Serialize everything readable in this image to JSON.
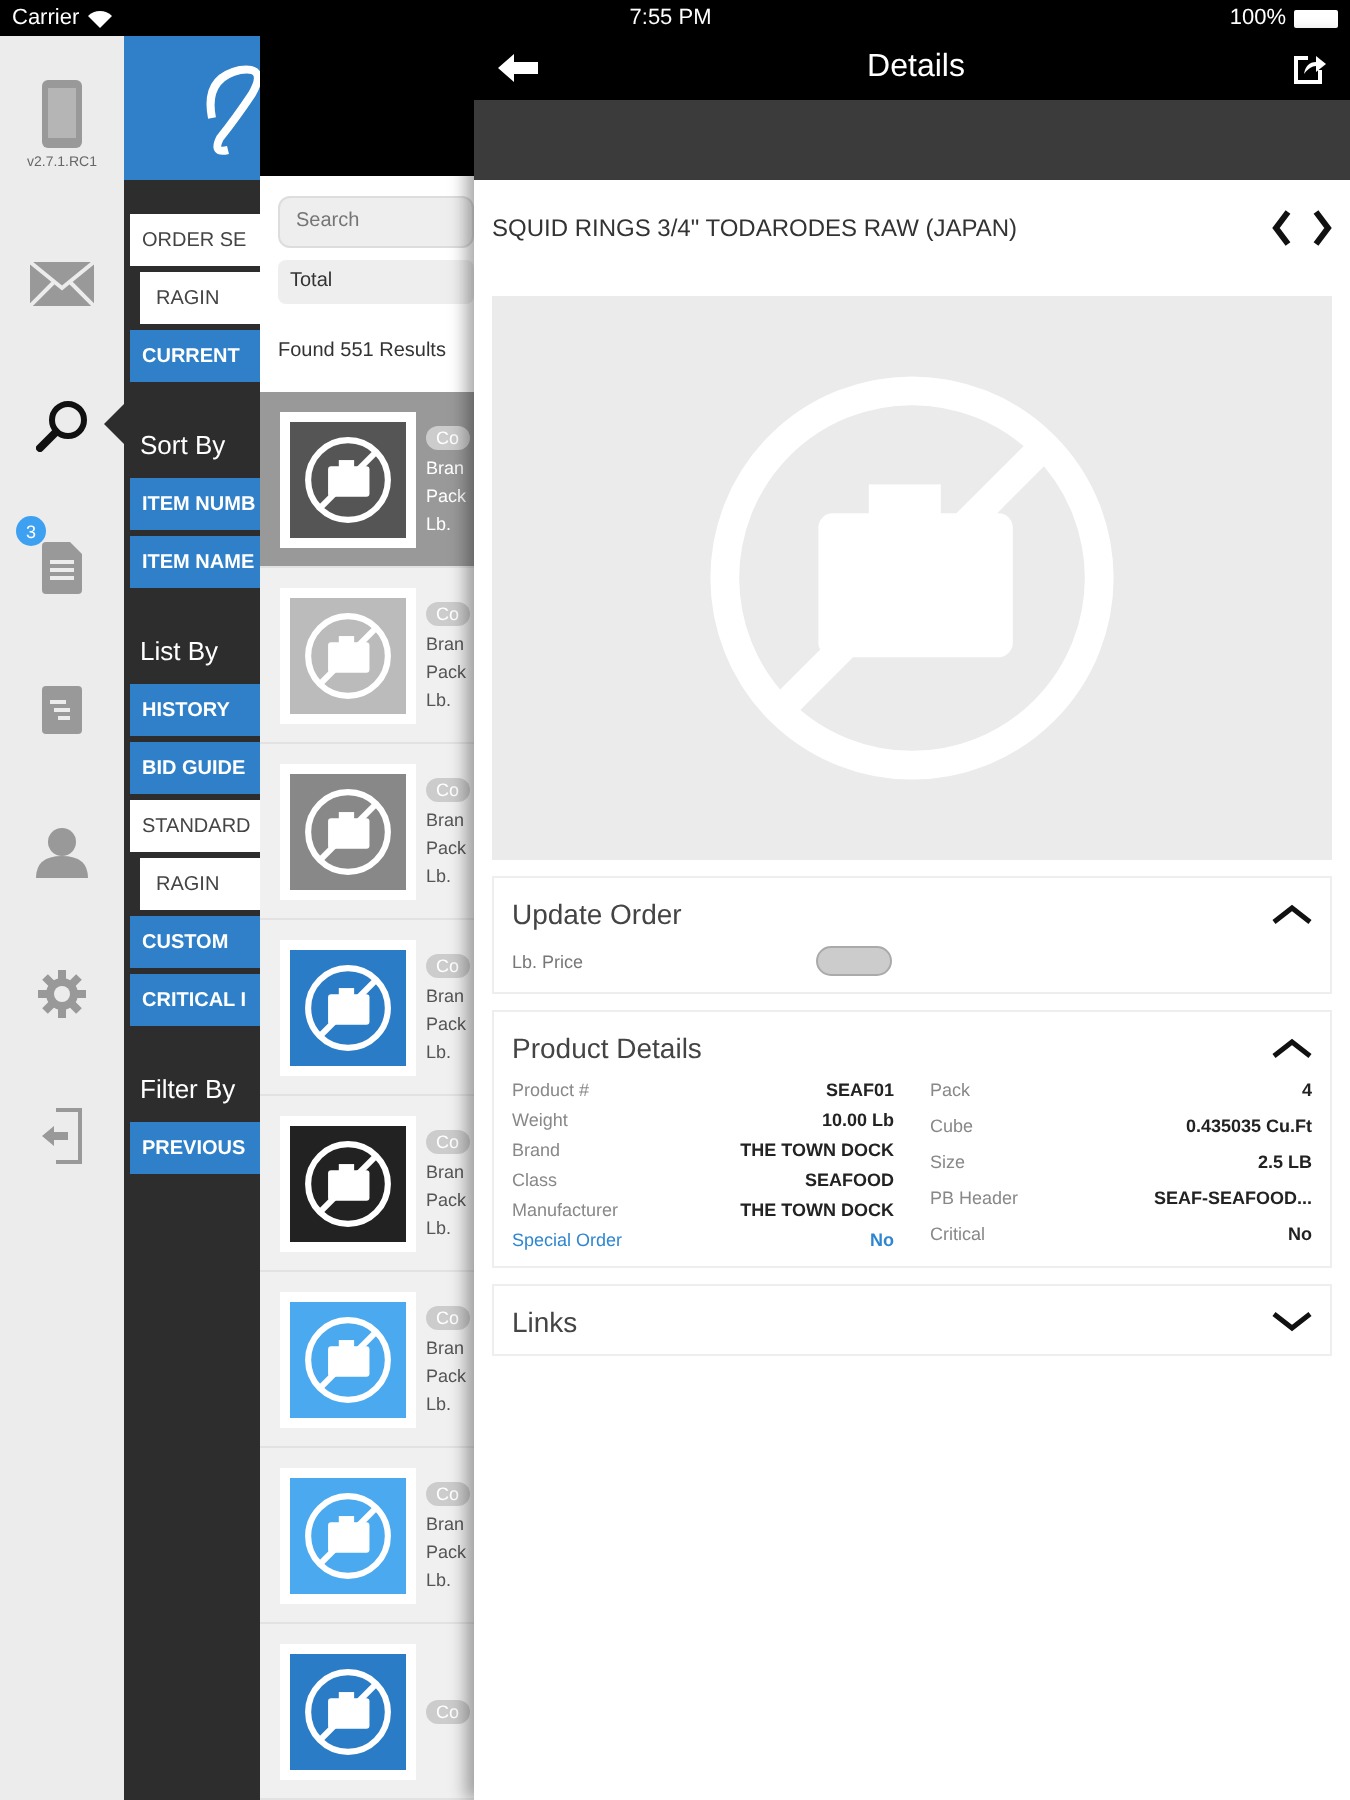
{
  "status_bar": {
    "carrier": "Carrier",
    "time": "7:55 PM",
    "battery": "100%"
  },
  "sidebar": {
    "version": "v2.7.1.RC1",
    "items": [
      {
        "kind": "mail",
        "selected": false
      },
      {
        "kind": "search",
        "selected": true
      },
      {
        "kind": "document",
        "selected": false,
        "badge": "3"
      },
      {
        "kind": "report",
        "selected": false
      },
      {
        "kind": "account",
        "selected": false
      },
      {
        "kind": "settings",
        "selected": false
      },
      {
        "kind": "logout",
        "selected": false
      }
    ]
  },
  "menu": {
    "sections": [
      {
        "items": [
          {
            "kind": "field",
            "label": "ORDER SE"
          },
          {
            "kind": "subfield",
            "label": "RAGIN"
          },
          {
            "kind": "button",
            "label": "CURRENT"
          }
        ]
      },
      {
        "heading": "Sort By",
        "items": [
          {
            "kind": "button",
            "label": "ITEM NUMB"
          },
          {
            "kind": "button",
            "label": "ITEM NAME"
          }
        ]
      },
      {
        "heading": "List By",
        "items": [
          {
            "kind": "button",
            "label": "HISTORY"
          },
          {
            "kind": "button",
            "label": "BID GUIDE"
          },
          {
            "kind": "field",
            "label": "STANDARD"
          },
          {
            "kind": "subfield",
            "label": "RAGIN"
          },
          {
            "kind": "button",
            "label": "CUSTOM"
          },
          {
            "kind": "button",
            "label": "CRITICAL I"
          }
        ]
      },
      {
        "heading": "Filter By",
        "items": [
          {
            "kind": "button",
            "label": "PREVIOUS"
          }
        ]
      }
    ]
  },
  "results": {
    "search_placeholder": "Search",
    "filter": "Total",
    "count": "Found 551 Results",
    "items": [
      {
        "selected": true,
        "color": "#555555",
        "tag": "Co",
        "lines": [
          "Bran",
          "Pack",
          "Lb."
        ]
      },
      {
        "selected": false,
        "color": "#bbbbbb",
        "tag": "Co",
        "lines": [
          "Bran",
          "Pack",
          "Lb."
        ]
      },
      {
        "selected": false,
        "color": "#888888",
        "tag": "Co",
        "lines": [
          "Bran",
          "Pack",
          "Lb."
        ]
      },
      {
        "selected": false,
        "color": "#2a7cc7",
        "tag": "Co",
        "lines": [
          "Bran",
          "Pack",
          "Lb."
        ]
      },
      {
        "selected": false,
        "color": "#222222",
        "tag": "Co",
        "lines": [
          "Bran",
          "Pack",
          "Lb."
        ]
      },
      {
        "selected": false,
        "color": "#4aa9ef",
        "tag": "Co",
        "lines": [
          "Bran",
          "Pack",
          "Lb."
        ]
      },
      {
        "selected": false,
        "color": "#4aa9ef",
        "tag": "Co",
        "lines": [
          "Bran",
          "Pack",
          "Lb."
        ]
      },
      {
        "selected": false,
        "color": "#2a7cc7",
        "tag": "Co"
      }
    ]
  },
  "details": {
    "title": "Details",
    "product": "SQUID RINGS 3/4\" TODARODES RAW (JAPAN)",
    "sections": [
      {
        "kind": "form",
        "title": "Update Order",
        "expanded": true,
        "fields": [
          {
            "label": "Lb. Price"
          }
        ]
      },
      {
        "kind": "grid",
        "title": "Product Details",
        "expanded": true,
        "columns": [
          [
            {
              "label": "Product #",
              "value": "SEAF01",
              "link": false
            },
            {
              "label": "Weight",
              "value": "10.00 Lb",
              "link": false
            },
            {
              "label": "Brand",
              "value": "THE TOWN DOCK",
              "link": false
            },
            {
              "label": "Class",
              "value": "SEAFOOD",
              "link": false
            },
            {
              "label": "Manufacturer",
              "value": "THE TOWN DOCK",
              "link": false
            },
            {
              "label": "Special Order",
              "value": "No",
              "link": true
            }
          ],
          [
            {
              "label": "Pack",
              "value": "4",
              "link": false
            },
            {
              "label": "Cube",
              "value": "0.435035 Cu.Ft",
              "link": false
            },
            {
              "label": "Size",
              "value": "2.5 LB",
              "link": false
            },
            {
              "label": "PB Header",
              "value": "SEAF-SEAFOOD...",
              "link": false
            },
            {
              "label": "Critical",
              "value": "No",
              "link": false
            }
          ]
        ]
      },
      {
        "kind": "list",
        "title": "Links",
        "expanded": false
      }
    ]
  }
}
